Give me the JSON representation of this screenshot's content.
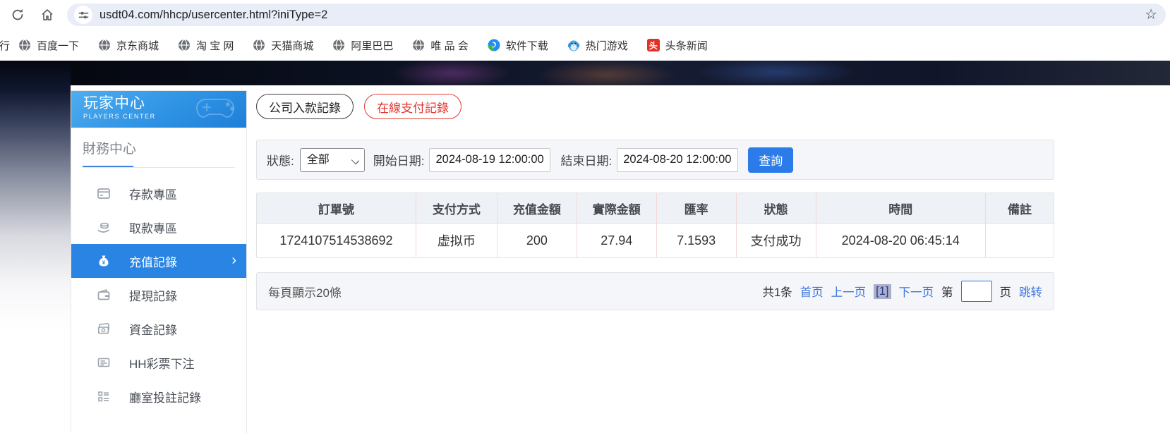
{
  "browser": {
    "url": "usdt04.com/hhcp/usercenter.html?iniType=2",
    "partial_bookmark_label": "行",
    "bookmarks": [
      {
        "label": "百度一下",
        "icon": "globe-favicon"
      },
      {
        "label": "京东商城",
        "icon": "globe-favicon"
      },
      {
        "label": "淘 宝 网",
        "icon": "globe-favicon"
      },
      {
        "label": "天猫商城",
        "icon": "globe-favicon"
      },
      {
        "label": "阿里巴巴",
        "icon": "globe-favicon"
      },
      {
        "label": "唯 品 会",
        "icon": "globe-favicon"
      },
      {
        "label": "软件下载",
        "icon": "software-download-favicon"
      },
      {
        "label": "热门游戏",
        "icon": "game-penguin-favicon"
      },
      {
        "label": "头条新闻",
        "icon": "toutiao-favicon",
        "badge_char": "头"
      }
    ]
  },
  "sidebar": {
    "title": "玩家中心",
    "subtitle": "PLAYERS CENTER",
    "section_title": "財務中心",
    "items": [
      {
        "label": "存款專區",
        "icon": "deposit-card-icon",
        "active": false
      },
      {
        "label": "取款專區",
        "icon": "withdraw-hand-icon",
        "active": false
      },
      {
        "label": "充值記錄",
        "icon": "money-bag-icon",
        "active": true
      },
      {
        "label": "提現記錄",
        "icon": "wallet-icon",
        "active": false
      },
      {
        "label": "資金記錄",
        "icon": "banknotes-icon",
        "active": false
      },
      {
        "label": "HH彩票下注",
        "icon": "ticket-list-icon",
        "active": false
      },
      {
        "label": "廳室投註記錄",
        "icon": "grid-list-icon",
        "active": false
      }
    ]
  },
  "tabs": [
    {
      "label": "公司入款記錄"
    },
    {
      "label": "在線支付記錄"
    }
  ],
  "filters": {
    "status_label": "狀態:",
    "status_value": "全部",
    "start_label": "開始日期:",
    "start_value": "2024-08-19 12:00:00",
    "end_label": "結束日期:",
    "end_value": "2024-08-20 12:00:00",
    "search_button": "查詢"
  },
  "table": {
    "headers": [
      "訂單號",
      "支付方式",
      "充值金額",
      "實際金額",
      "匯率",
      "狀態",
      "時間",
      "備註"
    ],
    "rows": [
      [
        "1724107514538692",
        "虚拟币",
        "200",
        "27.94",
        "7.1593",
        "支付成功",
        "2024-08-20 06:45:14",
        ""
      ]
    ]
  },
  "pagination": {
    "page_size_text": "每頁顯示20條",
    "total_text": "共1条",
    "first_label": "首页",
    "prev_label": "上一页",
    "current_label": "[1]",
    "next_label": "下一页",
    "jump_prefix": "第",
    "jump_value": "",
    "jump_suffix": "页",
    "jump_action": "跳转"
  },
  "colors": {
    "accent_blue": "#2b7ce9",
    "active_menu_blue": "#2a84e4",
    "link_blue": "#3c76dd",
    "tab_red": "#e3342f",
    "banner_blue_top": "#4fadef",
    "banner_blue_bottom": "#1d7fd7",
    "table_divider_pink": "#f3d8d8"
  }
}
